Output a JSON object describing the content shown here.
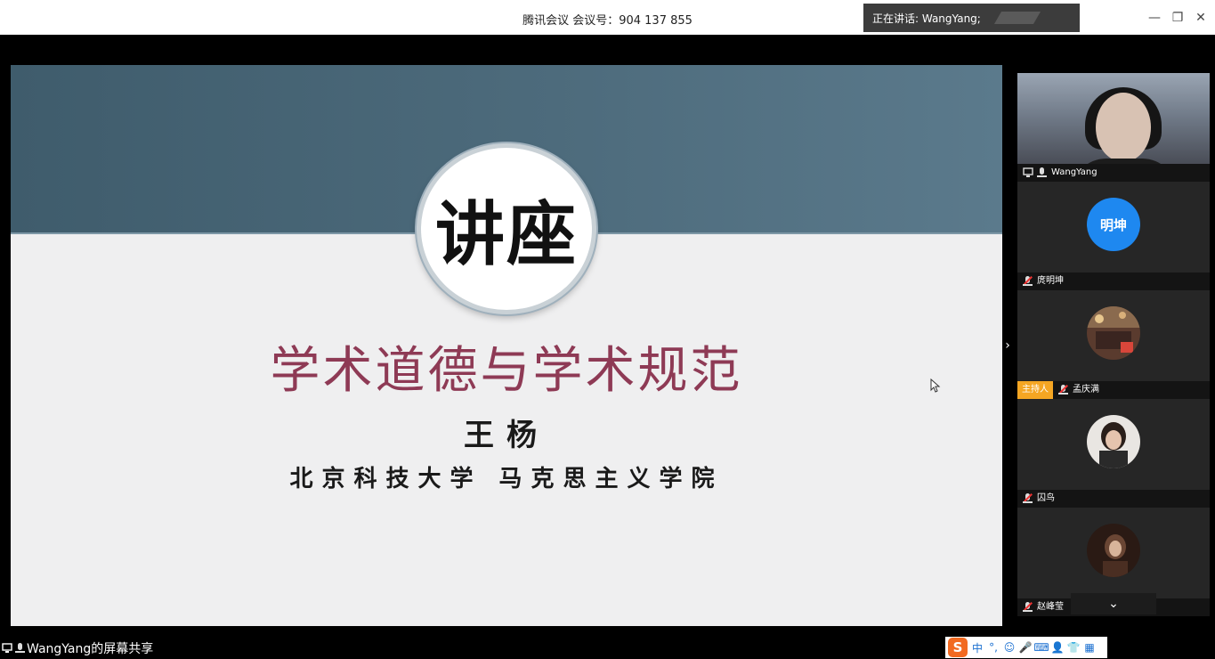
{
  "window": {
    "title": "腾讯会议 会议号：904 137 855",
    "speaking_label": "正在讲话: WangYang;",
    "controls": {
      "minimize": "—",
      "restore": "❐",
      "close": "✕"
    }
  },
  "slide": {
    "badge_text": "讲座",
    "title": "学术道德与学术规范",
    "author": "王杨",
    "institution": "北京科技大学 马克思主义学院"
  },
  "participants": [
    {
      "name": "WangYang",
      "type": "video",
      "muted": false
    },
    {
      "name": "庹明坤",
      "type": "initials",
      "initials": "明坤",
      "muted": true
    },
    {
      "name": "孟庆满",
      "type": "photo",
      "muted": true,
      "host_label": "主持人"
    },
    {
      "name": "囚鸟",
      "type": "photo",
      "muted": true
    },
    {
      "name": "赵峰莹",
      "type": "photo",
      "muted": true
    }
  ],
  "sidebar": {
    "collapse_icon": "›",
    "more_icon": "⌄"
  },
  "bottombar": {
    "share_label": "WangYang的屏幕共享"
  },
  "ime": {
    "logo": "S",
    "items": [
      "中",
      "°,",
      "☺",
      "🎤",
      "⌨",
      "👤",
      "👕",
      "▦"
    ]
  },
  "colors": {
    "slide_band": "#4d6b7c",
    "slide_title": "#8e3a55",
    "avatar_blue": "#1e88f0",
    "host_orange": "#f5a623"
  }
}
